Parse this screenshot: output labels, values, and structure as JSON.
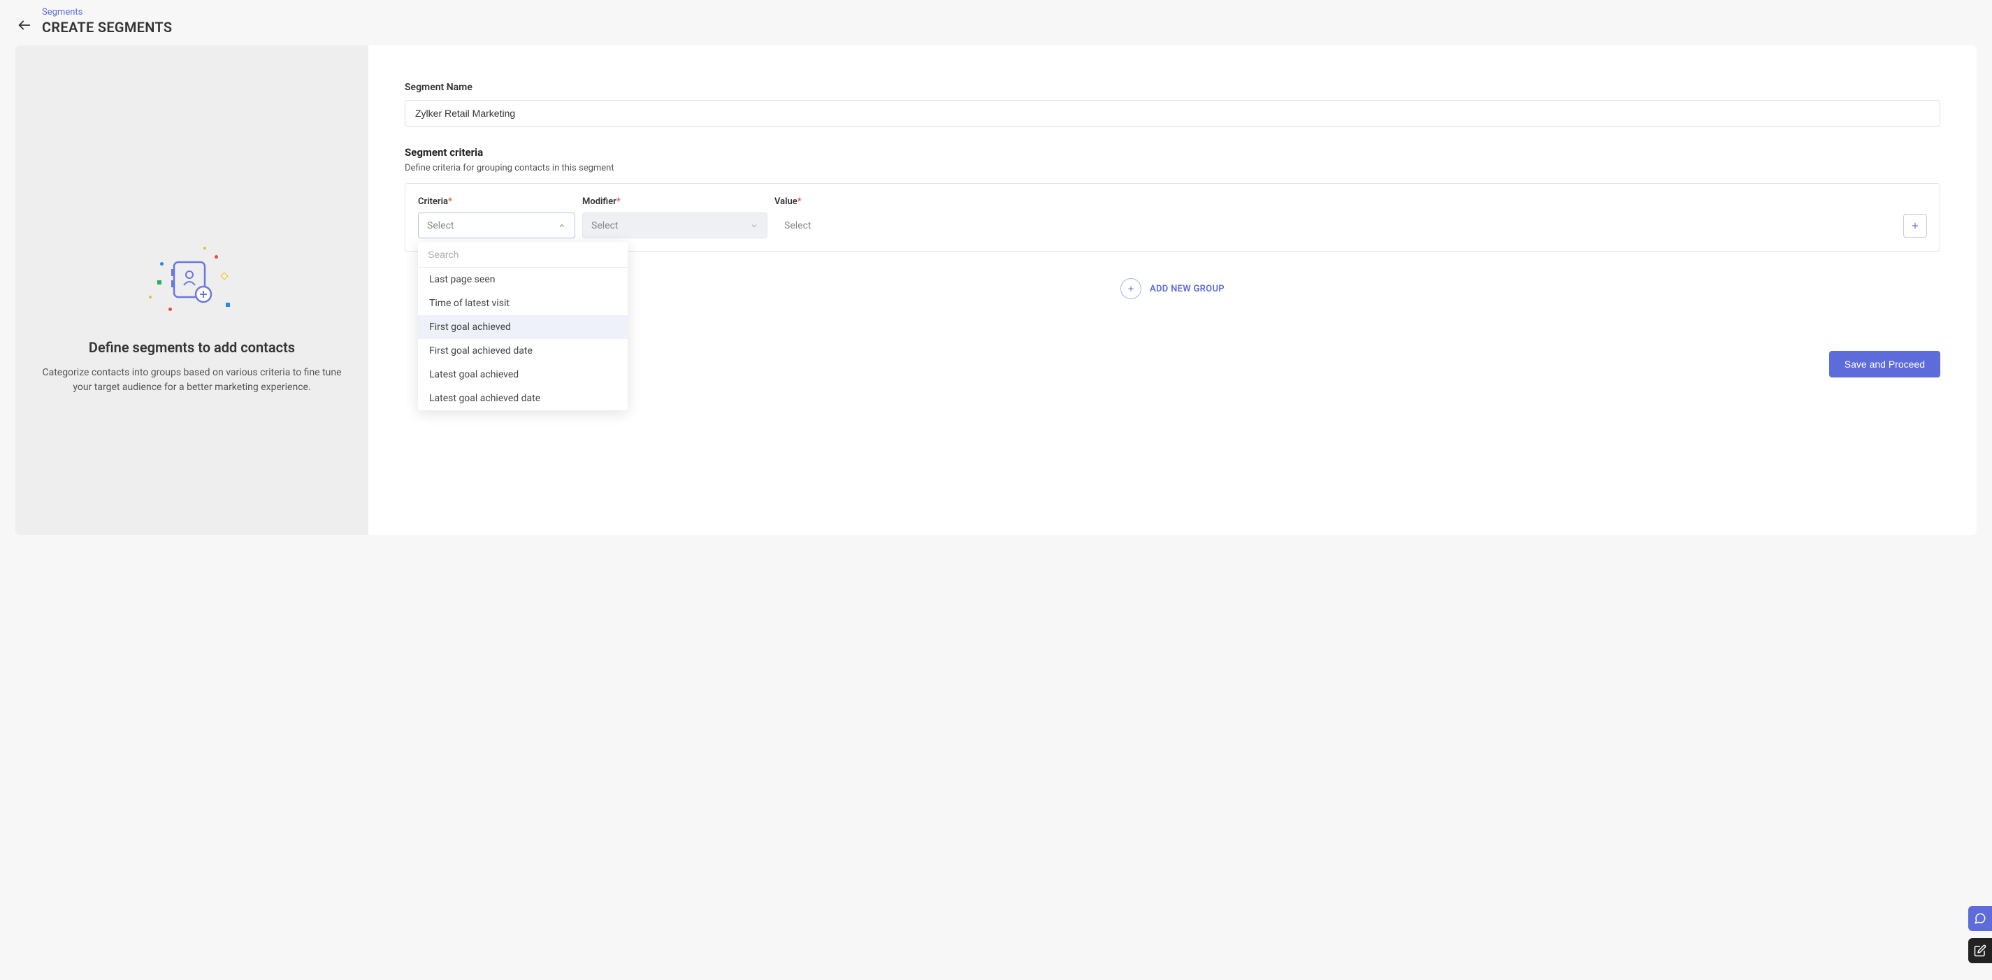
{
  "breadcrumb": {
    "link": "Segments"
  },
  "page": {
    "title": "CREATE SEGMENTS"
  },
  "left": {
    "title": "Define segments to add contacts",
    "desc": "Categorize contacts into groups based on various criteria to fine tune your target audience for a better marketing experience."
  },
  "form": {
    "segment_name_label": "Segment Name",
    "segment_name_value": "Zylker Retail Marketing",
    "criteria_title": "Segment criteria",
    "criteria_sub": "Define criteria for grouping contacts in this segment",
    "columns": {
      "criteria": "Criteria",
      "modifier": "Modifier",
      "value": "Value"
    },
    "select_placeholder": "Select",
    "dropdown": {
      "search_placeholder": "Search",
      "items": [
        "Last page seen",
        "Time of latest visit",
        "First goal achieved",
        "First goal achieved date",
        "Latest goal achieved",
        "Latest goal achieved date"
      ],
      "highlighted_index": 2
    },
    "add_group_label": "ADD NEW GROUP",
    "save_label": "Save and Proceed"
  }
}
